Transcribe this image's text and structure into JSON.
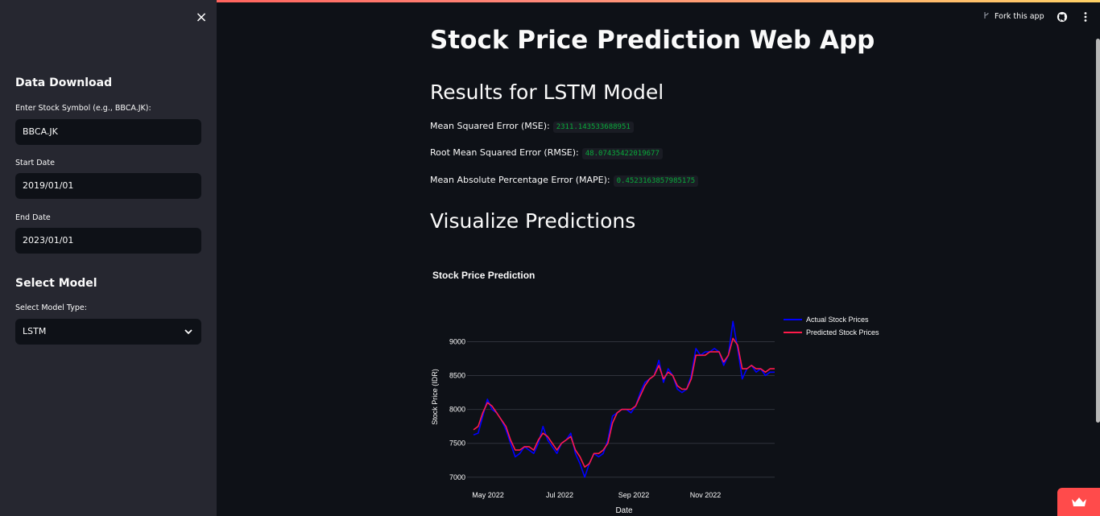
{
  "sidebar": {
    "close_label": "×",
    "data_download_header": "Data Download",
    "symbol_label": "Enter Stock Symbol (e.g., BBCA.JK):",
    "symbol_value": "BBCA.JK",
    "start_label": "Start Date",
    "start_value": "2019/01/01",
    "end_label": "End Date",
    "end_value": "2023/01/01",
    "model_header": "Select Model",
    "model_label": "Select Model Type:",
    "model_value": "LSTM"
  },
  "header": {
    "fork_label": "Fork this app",
    "github_icon": "github-icon",
    "menu_icon": "kebab-menu-icon"
  },
  "main": {
    "title": "Stock Price Prediction Web App",
    "results_header": "Results for LSTM Model",
    "mse_label": "Mean Squared Error (MSE):",
    "mse_value": "2311.143533688951",
    "rmse_label": "Root Mean Squared Error (RMSE):",
    "rmse_value": "48.07435422019677",
    "mape_label": "Mean Absolute Percentage Error (MAPE):",
    "mape_value": "0.4523163857985175",
    "viz_header": "Visualize Predictions"
  },
  "chart_data": {
    "type": "line",
    "title": "Stock Price Prediction",
    "xlabel": "Date",
    "ylabel": "Stock Price (IDR)",
    "x_ticks": [
      "May 2022",
      "Jul 2022",
      "Sep 2022",
      "Nov 2022"
    ],
    "y_ticks": [
      7000,
      7500,
      8000,
      8500,
      9000
    ],
    "ylim": [
      6950,
      9350
    ],
    "grid": true,
    "legend_position": "right",
    "series": [
      {
        "name": "Actual Stock Prices",
        "color": "#0000ff",
        "values": [
          7625,
          7650,
          7900,
          8150,
          8000,
          7950,
          7850,
          7700,
          7500,
          7300,
          7350,
          7450,
          7400,
          7350,
          7500,
          7750,
          7550,
          7450,
          7350,
          7500,
          7550,
          7650,
          7350,
          7200,
          7000,
          7200,
          7350,
          7300,
          7350,
          7550,
          7900,
          7950,
          8000,
          8000,
          7950,
          8050,
          8250,
          8400,
          8450,
          8500,
          8725,
          8400,
          8600,
          8500,
          8300,
          8250,
          8300,
          8500,
          8900,
          8800,
          8850,
          8850,
          8900,
          8850,
          8650,
          8800,
          9300,
          8900,
          8450,
          8600,
          8650,
          8550,
          8600,
          8500,
          8550,
          8550
        ]
      },
      {
        "name": "Predicted Stock Prices",
        "color": "#ff1a4a",
        "values": [
          7700,
          7750,
          7950,
          8100,
          8050,
          7950,
          7850,
          7750,
          7550,
          7400,
          7400,
          7450,
          7450,
          7400,
          7550,
          7650,
          7600,
          7500,
          7400,
          7500,
          7550,
          7600,
          7400,
          7300,
          7150,
          7200,
          7350,
          7350,
          7400,
          7500,
          7800,
          7950,
          8000,
          8000,
          8000,
          8050,
          8200,
          8350,
          8450,
          8500,
          8650,
          8450,
          8550,
          8500,
          8350,
          8300,
          8300,
          8450,
          8800,
          8800,
          8800,
          8850,
          8850,
          8850,
          8700,
          8800,
          9050,
          8950,
          8600,
          8600,
          8650,
          8600,
          8600,
          8550,
          8600,
          8600
        ]
      }
    ]
  }
}
